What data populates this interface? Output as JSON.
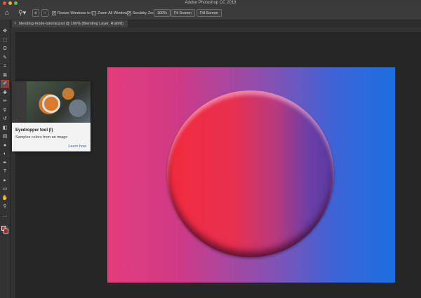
{
  "window": {
    "title": "Adobe Photoshop CC 2018",
    "traffic_lights": [
      "#e0574e",
      "#dfb03c",
      "#5fbf4b"
    ]
  },
  "options_bar": {
    "zoom_in_label": "+",
    "zoom_out_label": "−",
    "resize_windows_label": "Resize Windows to Fit",
    "zoom_all_windows_label": "Zoom All Windows",
    "scrubby_zoom_label": "Scrubby Zoom",
    "percent_button": "100%",
    "fit_screen_button": "Fit Screen",
    "fill_screen_button": "Fill Screen"
  },
  "document_tab": {
    "label": "blending-mode-tutorial.psd @ 100% (Blending Layer, RGB/8)",
    "close": "×"
  },
  "tools": [
    {
      "name": "move-tool",
      "glyph": "✥"
    },
    {
      "name": "marquee-tool",
      "glyph": "⬚"
    },
    {
      "name": "lasso-tool",
      "glyph": "ʘ"
    },
    {
      "name": "quick-select-tool",
      "glyph": "✎"
    },
    {
      "name": "crop-tool",
      "glyph": "⌗"
    },
    {
      "name": "frame-tool",
      "glyph": "⊠"
    },
    {
      "name": "eyedropper-tool",
      "glyph": "✐"
    },
    {
      "name": "healing-brush-tool",
      "glyph": "✚"
    },
    {
      "name": "brush-tool",
      "glyph": "✏"
    },
    {
      "name": "clone-stamp-tool",
      "glyph": "⚲"
    },
    {
      "name": "history-brush-tool",
      "glyph": "↺"
    },
    {
      "name": "eraser-tool",
      "glyph": "◧"
    },
    {
      "name": "gradient-tool",
      "glyph": "▤"
    },
    {
      "name": "blur-tool",
      "glyph": "●"
    },
    {
      "name": "dodge-tool",
      "glyph": "◐"
    },
    {
      "name": "pen-tool",
      "glyph": "✒"
    },
    {
      "name": "type-tool",
      "glyph": "T"
    },
    {
      "name": "path-select-tool",
      "glyph": "▸"
    },
    {
      "name": "shape-tool",
      "glyph": "▭"
    },
    {
      "name": "hand-tool",
      "glyph": "✋"
    },
    {
      "name": "zoom-tool",
      "glyph": "⚲"
    },
    {
      "name": "edit-toolbar",
      "glyph": "…"
    }
  ],
  "colors": {
    "foreground": "#d42a2a",
    "background": "#b01f1f"
  },
  "tooltip": {
    "title": "Eyedropper tool (I)",
    "description": "Samples colors from an image",
    "learn_more": "Learn how"
  }
}
